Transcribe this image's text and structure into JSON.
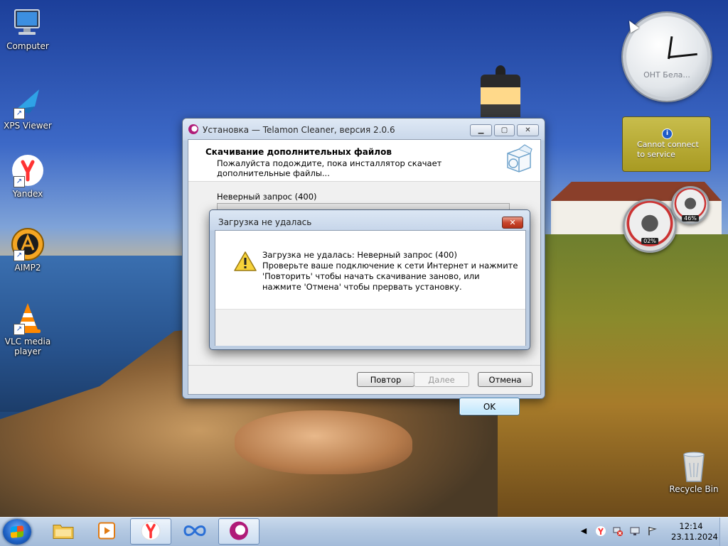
{
  "desktop": {
    "icons": [
      {
        "label": "Computer",
        "icon": "computer-icon"
      },
      {
        "label": "XPS Viewer",
        "icon": "xps-viewer-icon"
      },
      {
        "label": "Yandex",
        "icon": "yandex-icon"
      },
      {
        "label": "AIMP2",
        "icon": "aimp-icon"
      },
      {
        "label": "VLC media player",
        "icon": "vlc-icon"
      }
    ],
    "recycle_bin": {
      "label": "Recycle Bin",
      "icon": "recycle-bin-icon"
    }
  },
  "gadgets": {
    "clock": {
      "label": "ОНТ Бела..."
    },
    "weather": {
      "message": "Cannot connect to service"
    },
    "cpu_meter": {
      "cpu_value": "02%",
      "memory_value": "46%"
    }
  },
  "installer": {
    "title": "Установка — Telamon Cleaner, версия 2.0.6",
    "controls": {
      "minimize": "▁",
      "maximize": "▢",
      "close": "✕"
    },
    "header_title": "Скачивание дополнительных файлов",
    "header_subtitle": "Пожалуйста подождите, пока инсталлятор скачает дополнительные файлы...",
    "status": "Неверный запрос (400)",
    "buttons": {
      "retry": "Повтор",
      "next": "Далее",
      "cancel": "Отмена"
    }
  },
  "error_dialog": {
    "title": "Загрузка не удалась",
    "close": "✕",
    "message": "Загрузка не удалась: Неверный запрос (400)\nПроверьте ваше подключение к сети Интернет и нажмите 'Повторить' чтобы начать скачивание заново, или нажмите 'Отмена' чтобы прервать установку.",
    "ok": "OK"
  },
  "taskbar": {
    "items": [
      "start-button",
      "explorer-icon",
      "media-player-icon",
      "yandex-browser-icon",
      "infinity-app-icon",
      "telamon-cleaner-icon"
    ],
    "tray_icons": [
      "show-hidden-icons",
      "yandex-tray-icon",
      "network-error-icon",
      "display-icon",
      "flag-icon"
    ],
    "time": "12:14",
    "date": "23.11.2024"
  },
  "colors": {
    "accent": "#b01b78",
    "dialog_close": "#c9462d",
    "weather_gadget": "#b5a92f"
  }
}
